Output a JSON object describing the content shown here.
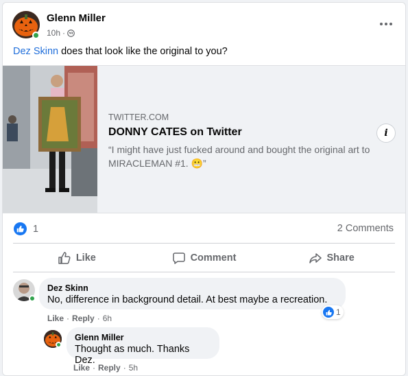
{
  "post": {
    "author": "Glenn Miller",
    "time": "10h",
    "separator": "·",
    "mention": "Dez Skinn",
    "text": " does that look like the original to you?"
  },
  "link_preview": {
    "domain": "TWITTER.COM",
    "title": "DONNY CATES on Twitter",
    "description": "“I might have just fucked around and bought the original art to MIRACLEMAN #1. 😬”",
    "info_label": "i"
  },
  "stats": {
    "reaction_count": "1",
    "comments": "2 Comments"
  },
  "actions": {
    "like": "Like",
    "comment": "Comment",
    "share": "Share"
  },
  "comments": [
    {
      "author": "Dez Skinn",
      "text": "No, difference in background detail. At best maybe a recreation.",
      "like_label": "Like",
      "reply_label": "Reply",
      "time": "6h",
      "reaction_count": "1"
    },
    {
      "author": "Glenn Miller",
      "text": "Thought as much. Thanks Dez.",
      "like_label": "Like",
      "reply_label": "Reply",
      "time": "5h"
    }
  ],
  "colors": {
    "accent": "#1877f2",
    "mention": "#216fdb",
    "online": "#31a24c",
    "pumpkin": "#e8620f"
  },
  "icons": [
    "pumpkin-avatar",
    "globe-icon",
    "more-options-icon",
    "info-icon",
    "like-icon",
    "comment-icon",
    "share-icon"
  ]
}
